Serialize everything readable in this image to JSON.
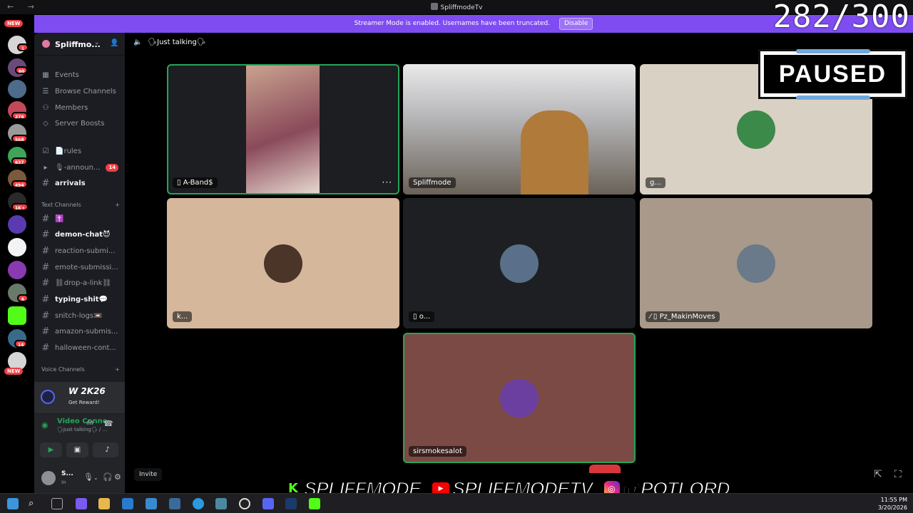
{
  "window": {
    "title": "SpliffmodeTv",
    "nav_glyphs": "← →"
  },
  "banner": {
    "message": "Streamer Mode is enabled. Usernames have been truncated.",
    "disable_label": "Disable"
  },
  "overlay": {
    "counter": "282/300",
    "paused_label": "PAUSED"
  },
  "rail": {
    "new_label": "NEW",
    "badges": [
      "1",
      "60",
      "276",
      "568",
      "637",
      "494",
      "1K+",
      "6",
      "14"
    ]
  },
  "server": {
    "name": "Spliffmo..."
  },
  "nav": {
    "events": "Events",
    "browse_channels": "Browse Channels",
    "members": "Members",
    "server_boosts": "Server Boosts"
  },
  "channels_top": [
    {
      "name": "📄rules",
      "bold": false
    },
    {
      "name": "🎙-announ...",
      "bold": false,
      "mentions": "14"
    },
    {
      "name": "arrivals",
      "bold": true
    }
  ],
  "text_category": "Text Channels",
  "text_channels": [
    {
      "name": "✝️",
      "bold": false
    },
    {
      "name": "demon-chat😈",
      "bold": true
    },
    {
      "name": "reaction-submi...",
      "bold": false
    },
    {
      "name": "emote-submissi...",
      "bold": false
    },
    {
      "name": "⛓drop-a-link⛓",
      "bold": false
    },
    {
      "name": "typing-shit💬",
      "bold": true
    },
    {
      "name": "snitch-logs📼",
      "bold": false
    },
    {
      "name": "amazon-submis...",
      "bold": false
    },
    {
      "name": "halloween-cont...",
      "bold": false
    }
  ],
  "voice_category": "Voice Channels",
  "promo": {
    "title": "W 2K26",
    "reward_label": "Get Reward!"
  },
  "voice_panel": {
    "status": "Video Connected",
    "channel": "🗣Just talking🗣 / ..."
  },
  "user": {
    "name": "S...",
    "status": "In"
  },
  "voice_channel": {
    "title": "🗣Just talking🗣"
  },
  "participants": [
    {
      "label": "A-Band$",
      "device_icon": "▯",
      "bg": "#1d1e21",
      "speaking": true,
      "avatar_color": ""
    },
    {
      "label": "Spliffmode",
      "device_icon": "",
      "bg": "#5c5a52",
      "speaking": false,
      "avatar_color": ""
    },
    {
      "label": "g...",
      "device_icon": "",
      "bg": "#d9d1c3",
      "speaking": false,
      "avatar_color": "#3c8a4a"
    },
    {
      "label": "k...",
      "device_icon": "",
      "bg": "#d5b79c",
      "speaking": false,
      "avatar_color": "#4a3528"
    },
    {
      "label": "o...",
      "device_icon": "▯",
      "bg": "#1e1f22",
      "speaking": false,
      "avatar_color": "#5a6f8a"
    },
    {
      "label": "Pz_MakinMoves",
      "device_icon": "▯",
      "bg": "#a8998a",
      "speaking": false,
      "avatar_color": "#6a7a8a"
    },
    {
      "label": "sirsmokesalot",
      "device_icon": "",
      "bg": "#7c4a44",
      "speaking": true,
      "avatar_color": "#6b3fa0"
    }
  ],
  "invite_label": "Invite",
  "social": {
    "kick": "SPLIFFMODE",
    "youtube": "SPLIFFMODETV",
    "instagram": "@POTLORD"
  },
  "clock": {
    "time": "11:55 PM",
    "date": "3/20/2026"
  }
}
